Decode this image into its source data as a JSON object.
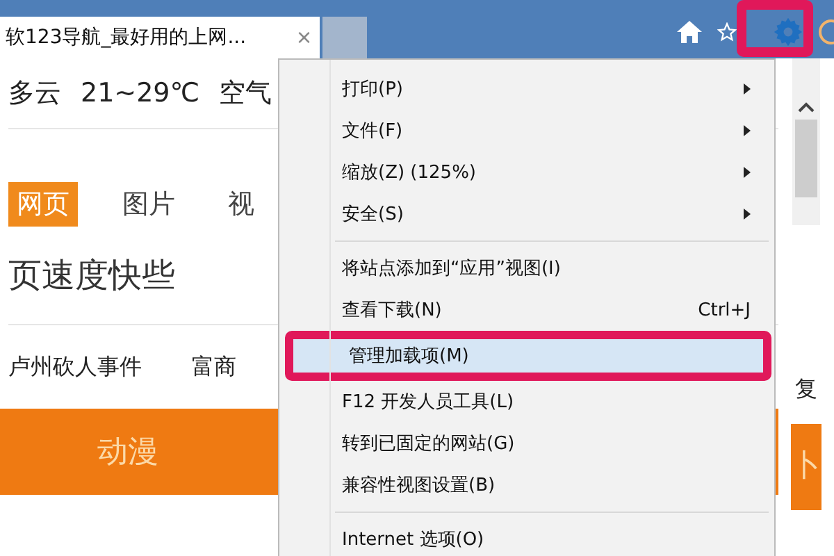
{
  "tab": {
    "title": "软123导航_最好用的上网...",
    "close": "×"
  },
  "page": {
    "weather": [
      "多云",
      "21~29℃",
      "空气"
    ],
    "search_tabs": [
      {
        "label": "网页",
        "selected": true
      },
      {
        "label": "图片",
        "selected": false
      },
      {
        "label": "视",
        "selected": false
      }
    ],
    "slogan": "页速度快些",
    "news": [
      "卢州砍人事件",
      "富商"
    ],
    "news_right": "复",
    "nav": [
      "动漫"
    ],
    "nav_right": "卜"
  },
  "menu": {
    "groups": [
      [
        {
          "label": "打印(P)",
          "submenu": true,
          "selected": false
        },
        {
          "label": "文件(F)",
          "submenu": true,
          "selected": false
        },
        {
          "label": "缩放(Z) (125%)",
          "submenu": true,
          "selected": false
        },
        {
          "label": "安全(S)",
          "submenu": true,
          "selected": false
        }
      ],
      [
        {
          "label": "将站点添加到“应用”视图(I)",
          "submenu": false,
          "selected": false
        },
        {
          "label": "查看下载(N)",
          "shortcut": "Ctrl+J",
          "submenu": false,
          "selected": false
        },
        {
          "label": "管理加载项(M)",
          "submenu": false,
          "selected": true,
          "highlighted": true
        },
        {
          "label": "F12 开发人员工具(L)",
          "submenu": false,
          "selected": false
        },
        {
          "label": "转到已固定的网站(G)",
          "submenu": false,
          "selected": false
        },
        {
          "label": "兼容性视图设置(B)",
          "submenu": false,
          "selected": false
        }
      ],
      [
        {
          "label": "Internet 选项(O)",
          "submenu": false,
          "selected": false
        }
      ]
    ]
  },
  "gear_highlighted": true
}
